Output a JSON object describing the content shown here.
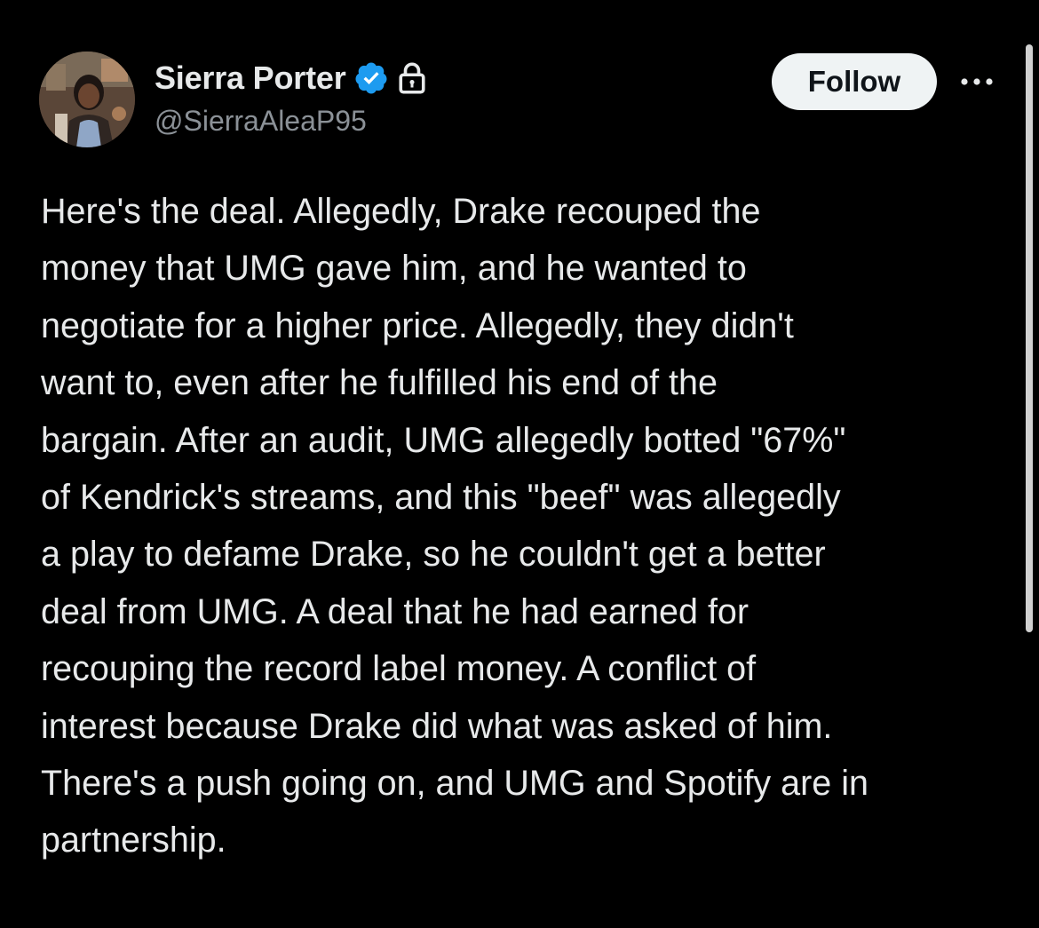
{
  "post": {
    "author": {
      "display_name": "Sierra Porter",
      "handle": "@SierraAleaP95",
      "verified": true,
      "protected": true,
      "verified_color": "#1d9bf0"
    },
    "follow_label": "Follow",
    "more_icon": "ellipsis-icon",
    "text_lines": [
      "Here's the deal. Allegedly, Drake recouped the",
      "money that UMG gave him, and he wanted to",
      "negotiate for a higher price. Allegedly, they didn't",
      "want to, even after he fulfilled his end of the",
      "bargain. After an audit, UMG allegedly botted \"67%\"",
      "of Kendrick's streams, and this \"beef\" was allegedly",
      "a play to defame Drake, so he couldn't get a better",
      "deal from UMG. A deal that he had earned for",
      "recouping the record label money. A conflict of",
      "interest because Drake did what was asked of him.",
      "There's a push going on, and UMG and Spotify are in",
      "partnership."
    ]
  },
  "theme": {
    "background": "#000000",
    "text": "#e7e9ea",
    "secondary_text": "#8b9197",
    "follow_bg": "#eff3f4",
    "follow_text": "#0f1419"
  }
}
